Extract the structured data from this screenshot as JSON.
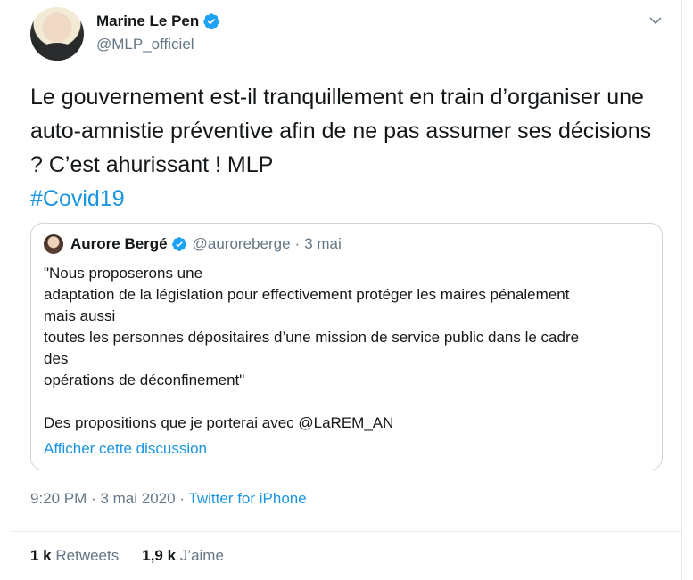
{
  "author": {
    "name": "Marine Le Pen",
    "handle": "@MLP_officiel"
  },
  "tweet": {
    "text_main": "Le gouvernement est-il tranquillement en train d’organiser une auto-amnistie préventive afin de ne pas assumer ses décisions ? C’est ahurissant ! MLP",
    "hashtag": "#Covid19"
  },
  "quoted": {
    "name": "Aurore Bergé",
    "handle": "@auroreberge",
    "separator": "·",
    "date": "3 mai",
    "lines": [
      "\"Nous proposerons une",
      "adaptation de la législation pour effectivement protéger les maires pénalement",
      "mais aussi",
      "toutes les personnes dépositaires d’une mission de service public dans le cadre",
      "des",
      "opérations de déconfinement\"",
      "",
      "Des propositions que je porterai avec @LaREM_AN"
    ],
    "show_thread": "Afficher cette discussion"
  },
  "meta": {
    "time": "9:20 PM",
    "separator1": "·",
    "date": "3 mai 2020",
    "separator2": "·",
    "source": "Twitter for iPhone"
  },
  "stats": {
    "retweets_count": "1 k",
    "retweets_label": "Retweets",
    "likes_count": "1,9 k",
    "likes_label": "J’aime"
  },
  "colors": {
    "link": "#1b95e0",
    "secondary": "#657786",
    "verified": "#1da1f2"
  },
  "icons": [
    "verified-badge-icon",
    "chevron-down-icon"
  ]
}
